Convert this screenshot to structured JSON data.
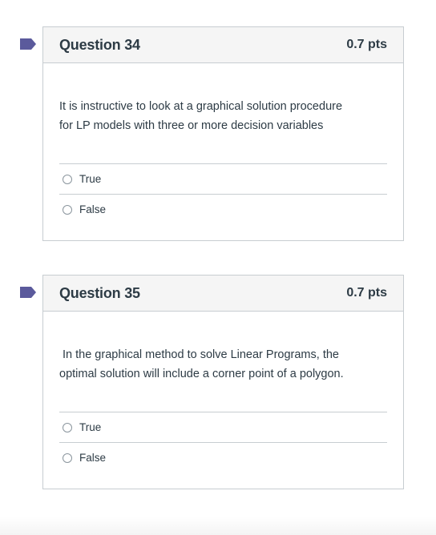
{
  "questions": [
    {
      "title": "Question 34",
      "points": "0.7 pts",
      "text_line1": "It is instructive to look at a graphical solution procedure",
      "text_line2": "for LP models with three or more decision variables",
      "answers": [
        "True",
        "False"
      ],
      "flag_color": "#5b5a9c"
    },
    {
      "title": "Question 35",
      "points": "0.7 pts",
      "text_line1": "In the graphical method to solve Linear Programs, the",
      "text_line2": "optimal solution will include a corner point of a polygon.",
      "answers": [
        "True",
        "False"
      ],
      "flag_color": "#5b5a9c"
    }
  ]
}
